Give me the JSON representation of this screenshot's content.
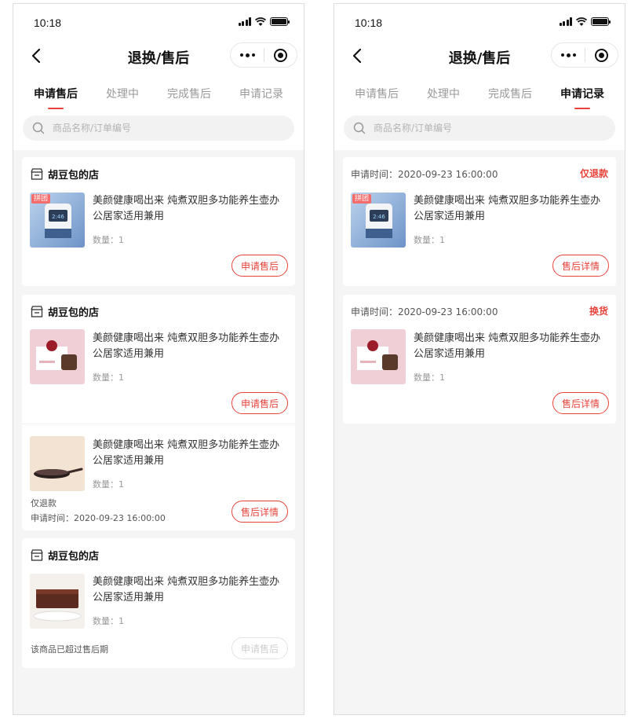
{
  "status_bar": {
    "time": "10:18"
  },
  "nav": {
    "title": "退换/售后"
  },
  "tabs": [
    "申请售后",
    "处理中",
    "完成售后",
    "申请记录"
  ],
  "search": {
    "placeholder": "商品名称/订单编号"
  },
  "product_name": "美颜健康喝出来 炖煮双胆多功能养生壶办公居家适用兼用",
  "quantity_text": "数量：1",
  "group_tag": "拼团",
  "left_screen": {
    "active_tab": 0,
    "cards": [
      {
        "store": "胡豆包的店",
        "button": "申请售后"
      },
      {
        "store": "胡豆包的店",
        "button": "申请售后",
        "extra_item": {
          "status": "仅退款",
          "apply_time": "申请时间：2020-09-23 16:00:00",
          "button": "售后详情"
        }
      },
      {
        "store": "胡豆包的店",
        "expired_note": "该商品已超过售后期",
        "button": "申请售后"
      }
    ]
  },
  "right_screen": {
    "active_tab": 3,
    "records": [
      {
        "apply_time": "申请时间：2020-09-23 16:00:00",
        "type": "仅退款",
        "button": "售后详情"
      },
      {
        "apply_time": "申请时间：2020-09-23 16:00:00",
        "type": "换货",
        "button": "售后详情"
      }
    ]
  },
  "colors": {
    "accent": "#e8433b",
    "background": "#f5f5f5"
  },
  "icons": [
    "back-arrow-icon",
    "more-dots-icon",
    "close-target-icon",
    "search-icon",
    "store-icon",
    "signal-icon",
    "wifi-icon",
    "battery-icon"
  ]
}
